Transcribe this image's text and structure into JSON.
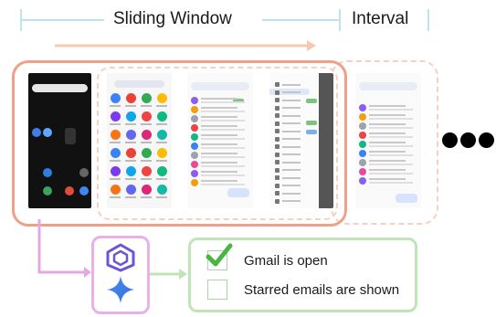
{
  "header": {
    "sliding_window": "Sliding Window",
    "interval": "Interval"
  },
  "status_checks": [
    {
      "label": "Gmail is open",
      "checked": true
    },
    {
      "label": "Starred emails are shown",
      "checked": false
    }
  ],
  "colors": {
    "window_frame": "#f0a088",
    "interval_frame": "#f3d2c4",
    "range_lines": "#bde3f0",
    "arrow": "#f7c8b0",
    "connector": "#e4a8e4",
    "model_box": "#e9b0ea",
    "result_box": "#bfe5b6",
    "check_green": "#4bb543"
  },
  "icons": [
    "model-logo-icon",
    "sparkle-icon",
    "checkmark-icon"
  ]
}
